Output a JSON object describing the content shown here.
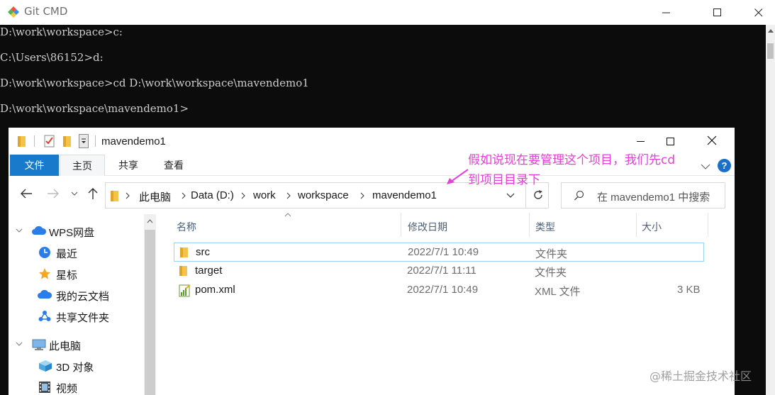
{
  "cmd": {
    "title": "Git CMD",
    "lines": [
      "D:\\work\\workspace>c:",
      "C:\\Users\\86152>d:",
      "D:\\work\\workspace>cd D:\\work\\workspace\\mavendemo1",
      "D:\\work\\workspace\\mavendemo1>"
    ]
  },
  "explorer": {
    "title": "mavendemo1",
    "ribbon": {
      "file": "文件",
      "home": "主页",
      "share": "共享",
      "view": "查看",
      "help": "?"
    },
    "annotation": {
      "line1": "假如说现在要管理这个项目，我们先cd",
      "line2": "到项目目录下",
      "color": "#e63fd9"
    },
    "breadcrumb": [
      "此电脑",
      "Data (D:)",
      "work",
      "workspace",
      "mavendemo1"
    ],
    "search_placeholder": "在 mavendemo1 中搜索",
    "nav": [
      {
        "label": "WPS网盘",
        "icon": "cloud-icon"
      },
      {
        "label": "最近",
        "icon": "clock-icon"
      },
      {
        "label": "星标",
        "icon": "star-icon"
      },
      {
        "label": "我的云文档",
        "icon": "cloud-docs-icon"
      },
      {
        "label": "共享文件夹",
        "icon": "shared-folder-icon"
      },
      {
        "label": "此电脑",
        "icon": "computer-icon"
      },
      {
        "label": "3D 对象",
        "icon": "cube-icon"
      },
      {
        "label": "视频",
        "icon": "film-icon"
      }
    ],
    "columns": {
      "name": "名称",
      "date": "修改日期",
      "type": "类型",
      "size": "大小"
    },
    "files": [
      {
        "name": "src",
        "date": "2022/7/1 10:49",
        "type": "文件夹",
        "size": "",
        "icon": "folder-icon"
      },
      {
        "name": "target",
        "date": "2022/7/1 11:11",
        "type": "文件夹",
        "size": "",
        "icon": "folder-icon"
      },
      {
        "name": "pom.xml",
        "date": "2022/7/1 10:49",
        "type": "XML 文件",
        "size": "3 KB",
        "icon": "xml-file-icon"
      }
    ]
  },
  "watermark": "@稀土掘金技术社区"
}
